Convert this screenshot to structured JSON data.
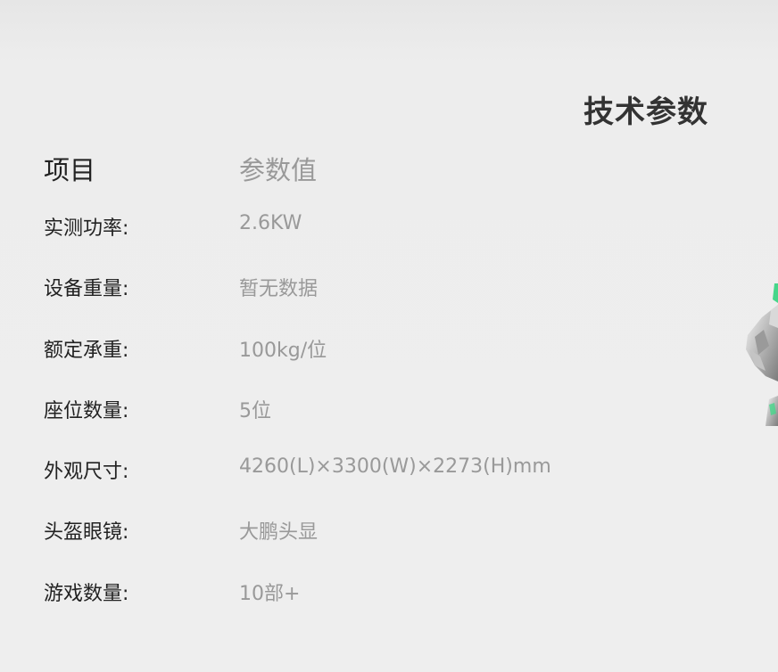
{
  "section": {
    "title": "技术参数"
  },
  "table": {
    "header": {
      "key": "项目",
      "value": "参数值"
    },
    "rows": [
      {
        "key": "实测功率:",
        "value": "2.6KW"
      },
      {
        "key": "设备重量:",
        "value": "暂无数据"
      },
      {
        "key": "额定承重:",
        "value": "100kg/位"
      },
      {
        "key": "座位数量:",
        "value": "5位"
      },
      {
        "key": "外观尺寸:",
        "value": "4260(L)×3300(W)×2273(H)mm"
      },
      {
        "key": "头盔眼镜:",
        "value": "大鹏头显"
      },
      {
        "key": "游戏数量:",
        "value": "10部+"
      }
    ]
  },
  "colors": {
    "background": "#eeeeee",
    "title": "#333333",
    "key_text": "#222222",
    "value_text": "#999999",
    "product_accent": "#46d68a"
  }
}
